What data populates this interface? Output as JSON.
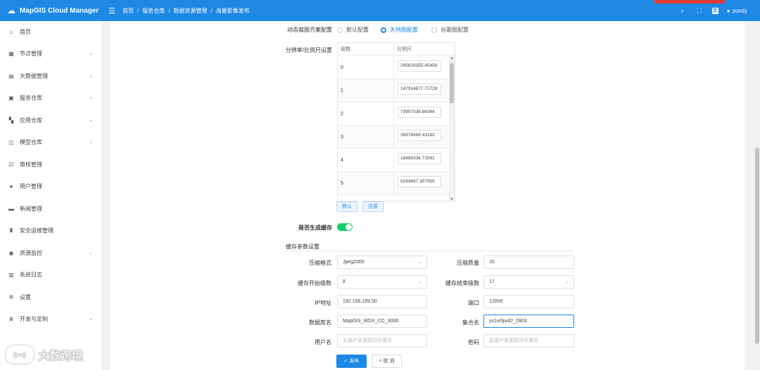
{
  "header": {
    "app_title": "MapGIS Cloud Manager",
    "breadcrumbs": [
      "首页",
      "服务仓库",
      "数据资源管理",
      "海量影像发布"
    ],
    "user": "zondy"
  },
  "sidebar": {
    "items": [
      {
        "label": "首页",
        "icon": "home-icon",
        "expandable": false
      },
      {
        "label": "节点管理",
        "icon": "node-icon",
        "expandable": true
      },
      {
        "label": "大数据管理",
        "icon": "bigdata-icon",
        "expandable": true
      },
      {
        "label": "服务仓库",
        "icon": "service-icon",
        "expandable": true
      },
      {
        "label": "应用仓库",
        "icon": "app-grid-icon",
        "expandable": true
      },
      {
        "label": "模型仓库",
        "icon": "model-icon",
        "expandable": true
      },
      {
        "label": "审核管理",
        "icon": "audit-icon",
        "expandable": false
      },
      {
        "label": "用户管理",
        "icon": "user-icon",
        "expandable": false
      },
      {
        "label": "新闻管理",
        "icon": "news-icon",
        "expandable": false
      },
      {
        "label": "安全运维管理",
        "icon": "security-icon",
        "expandable": false
      },
      {
        "label": "资源监控",
        "icon": "monitor-icon",
        "expandable": true
      },
      {
        "label": "系统日志",
        "icon": "log-icon",
        "expandable": false
      },
      {
        "label": "设置",
        "icon": "gear-icon",
        "expandable": false
      },
      {
        "label": "开发与定制",
        "icon": "dev-icon",
        "expandable": true
      }
    ]
  },
  "form": {
    "scheme": {
      "label": "动态裁图方案配置",
      "options": [
        "默认配置",
        "天地图配置",
        "谷歌图配置"
      ],
      "selected": 1
    },
    "resolution": {
      "label": "分辨率/比例尺设置",
      "col_level": "级数",
      "col_scale": "比例尺",
      "rows": [
        {
          "level": "0",
          "scale": "295829355.45456"
        },
        {
          "level": "1",
          "scale": "147914677.72728"
        },
        {
          "level": "2",
          "scale": "73957338.86364"
        },
        {
          "level": "3",
          "scale": "36978669.43182"
        },
        {
          "level": "4",
          "scale": "18489334.71591"
        },
        {
          "level": "5",
          "scale": "9244667.357955"
        }
      ],
      "default_btn": "默认",
      "restore_btn": "还原"
    },
    "gen_cache": {
      "label": "是否生成缓存",
      "on": true
    },
    "cache_section": "缓存参数设置",
    "compress_format": {
      "label": "压缩格式",
      "value": "Jpeg2000"
    },
    "compress_quality": {
      "label": "压缩质量",
      "value": "20"
    },
    "cache_start": {
      "label": "缓存开始级数",
      "value": "8"
    },
    "cache_end": {
      "label": "缓存结束级数",
      "value": "17"
    },
    "ip": {
      "label": "IP地址",
      "value": "192.168.199.50"
    },
    "port": {
      "label": "端口",
      "value": "12000"
    },
    "db_name": {
      "label": "数据库名",
      "value": "MapGIS_WDX_CC_3000"
    },
    "set_name": {
      "label": "集合名",
      "value": "yx1w5jwd2_0903"
    },
    "username": {
      "label": "用户名",
      "placeholder": "无用户名密码可不填写"
    },
    "password": {
      "label": "密码",
      "placeholder": "无用户名密码可不填写"
    },
    "publish_btn": "发布",
    "cancel_btn": "取 消"
  },
  "watermark": {
    "logo_text": "(◕◕)",
    "text": "大数跨境"
  },
  "colors": {
    "primary": "#1e88e5",
    "switch_on": "#13ce66"
  }
}
